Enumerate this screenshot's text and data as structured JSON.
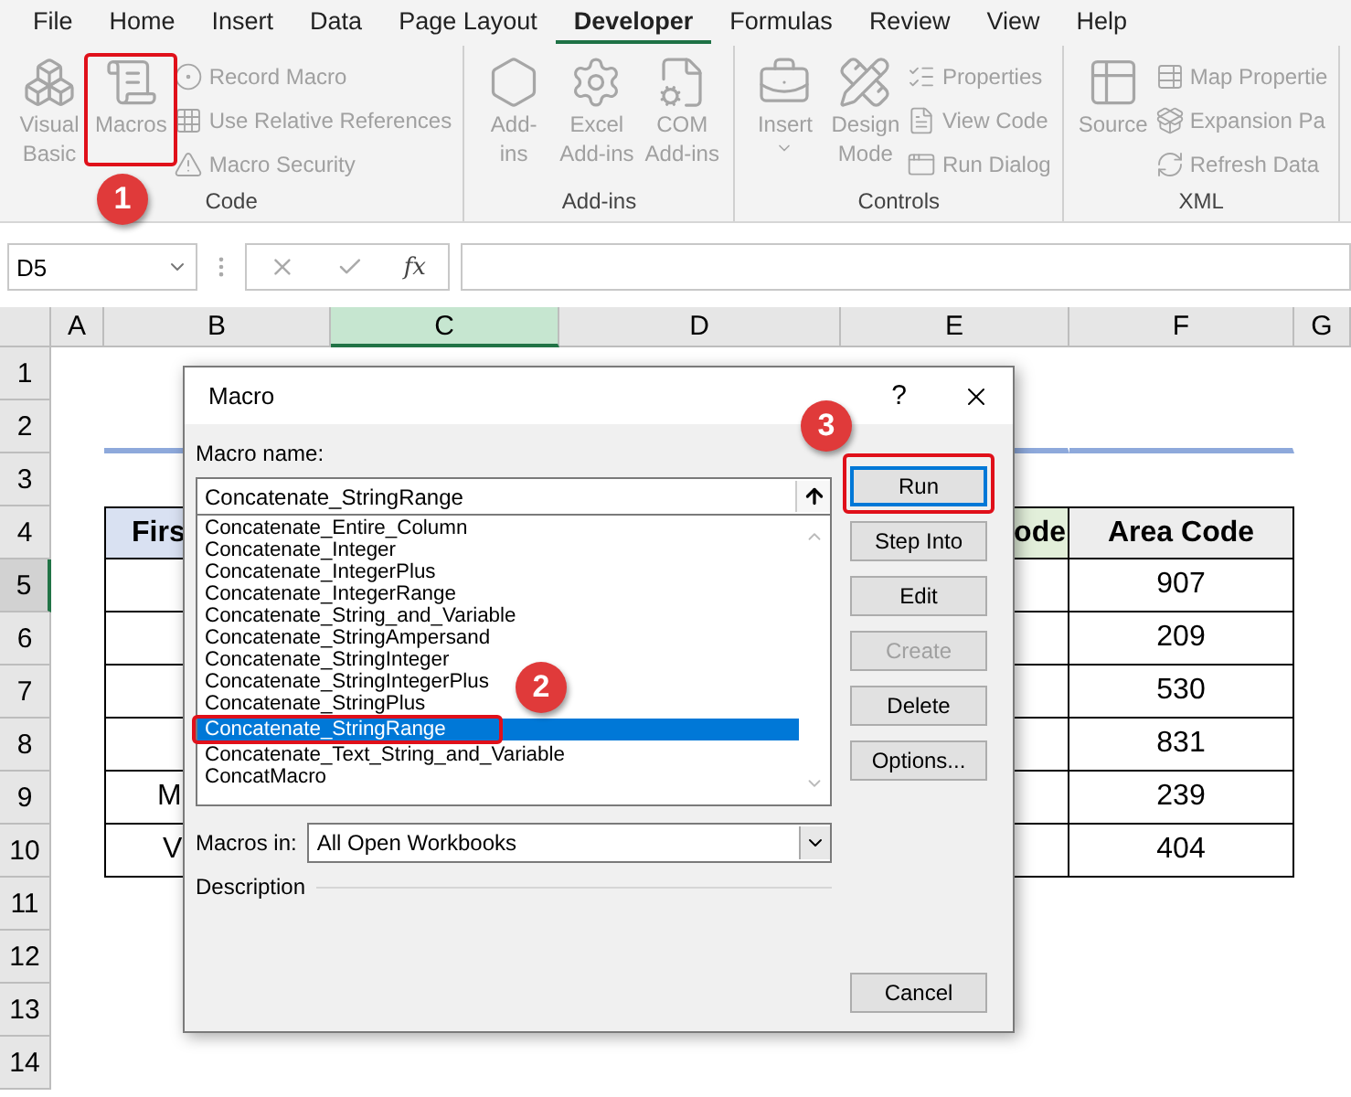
{
  "menu_tabs": [
    {
      "label": "File",
      "selected": false
    },
    {
      "label": "Home",
      "selected": false
    },
    {
      "label": "Insert",
      "selected": false
    },
    {
      "label": "Data",
      "selected": false
    },
    {
      "label": "Page Layout",
      "selected": false
    },
    {
      "label": "Developer",
      "selected": true
    },
    {
      "label": "Formulas",
      "selected": false
    },
    {
      "label": "Review",
      "selected": false
    },
    {
      "label": "View",
      "selected": false
    },
    {
      "label": "Help",
      "selected": false
    }
  ],
  "ribbon_groups": [
    {
      "label": "Code",
      "items": [
        {
          "kind": "large",
          "lines": [
            "Visual",
            "Basic"
          ]
        },
        {
          "kind": "large",
          "lines": [
            "Macros"
          ]
        },
        {
          "kind": "stack",
          "items": [
            "Record Macro",
            "Use Relative References",
            "Macro Security"
          ]
        }
      ]
    },
    {
      "label": "Add-ins",
      "items": [
        {
          "kind": "large",
          "lines": [
            "Add-",
            "ins"
          ]
        },
        {
          "kind": "large",
          "lines": [
            "Excel",
            "Add-ins"
          ]
        },
        {
          "kind": "large",
          "lines": [
            "COM",
            "Add-ins"
          ]
        }
      ]
    },
    {
      "label": "Controls",
      "items": [
        {
          "kind": "dropdown",
          "lines": [
            "Insert"
          ]
        },
        {
          "kind": "large",
          "lines": [
            "Design",
            "Mode"
          ]
        },
        {
          "kind": "stack",
          "items": [
            "Properties",
            "View Code",
            "Run Dialog"
          ]
        }
      ]
    },
    {
      "label": "XML",
      "items": [
        {
          "kind": "large",
          "lines": [
            "Source"
          ]
        },
        {
          "kind": "stack",
          "items": [
            "Map Propertie",
            "Expansion Pa",
            "Refresh Data"
          ]
        }
      ]
    }
  ],
  "formula_bar": {
    "name_box": "D5",
    "function_label": "fx"
  },
  "column_headers": [
    {
      "label": "A",
      "selected": false
    },
    {
      "label": "B",
      "selected": false
    },
    {
      "label": "C",
      "selected": true
    },
    {
      "label": "D",
      "selected": false
    },
    {
      "label": "E",
      "selected": false
    },
    {
      "label": "F",
      "selected": false
    },
    {
      "label": "G",
      "selected": false
    }
  ],
  "row_headers": [
    {
      "label": "1",
      "selected": false
    },
    {
      "label": "2",
      "selected": false
    },
    {
      "label": "3",
      "selected": false
    },
    {
      "label": "4",
      "selected": false
    },
    {
      "label": "5",
      "selected": true
    },
    {
      "label": "6",
      "selected": false
    },
    {
      "label": "7",
      "selected": false
    },
    {
      "label": "8",
      "selected": false
    },
    {
      "label": "9",
      "selected": false
    },
    {
      "label": "10",
      "selected": false
    },
    {
      "label": "11",
      "selected": false
    },
    {
      "label": "12",
      "selected": false
    },
    {
      "label": "13",
      "selected": false
    },
    {
      "label": "14",
      "selected": false
    }
  ],
  "table": {
    "header": {
      "column_1": "Firs",
      "column_4": "ode",
      "column_5": "Area Code"
    },
    "rows": [
      {
        "column_5": "907"
      },
      {
        "column_5": "209"
      },
      {
        "column_5": "530"
      },
      {
        "column_5": "831"
      },
      {
        "column_1": "M",
        "column_5": "239"
      },
      {
        "column_1": "V",
        "column_5": "404"
      }
    ]
  },
  "dialog": {
    "title": "Macro",
    "help": "?",
    "name_label": "Macro name:",
    "name_value": "Concatenate_StringRange",
    "macros": [
      {
        "label": "Concatenate_Entire_Column",
        "selected": false
      },
      {
        "label": "Concatenate_Integer",
        "selected": false
      },
      {
        "label": "Concatenate_IntegerPlus",
        "selected": false
      },
      {
        "label": "Concatenate_IntegerRange",
        "selected": false
      },
      {
        "label": "Concatenate_String_and_Variable",
        "selected": false
      },
      {
        "label": "Concatenate_StringAmpersand",
        "selected": false
      },
      {
        "label": "Concatenate_StringInteger",
        "selected": false
      },
      {
        "label": "Concatenate_StringIntegerPlus",
        "selected": false
      },
      {
        "label": "Concatenate_StringPlus",
        "selected": false
      },
      {
        "label": "Concatenate_StringRange",
        "selected": true
      },
      {
        "label": "Concatenate_Text_String_and_Variable",
        "selected": false
      },
      {
        "label": "ConcatMacro",
        "selected": false
      }
    ],
    "macros_in_label": "Macros in:",
    "macros_in_value": "All Open Workbooks",
    "description_label": "Description",
    "buttons": [
      {
        "label": "Run",
        "default": true,
        "disabled": false
      },
      {
        "label": "Step Into",
        "default": false,
        "disabled": false
      },
      {
        "label": "Edit",
        "default": false,
        "disabled": false
      },
      {
        "label": "Create",
        "default": false,
        "disabled": true
      },
      {
        "label": "Delete",
        "default": false,
        "disabled": false
      },
      {
        "label": "Options...",
        "default": false,
        "disabled": false
      }
    ],
    "cancel": "Cancel"
  },
  "callouts": [
    "1",
    "2",
    "3"
  ]
}
